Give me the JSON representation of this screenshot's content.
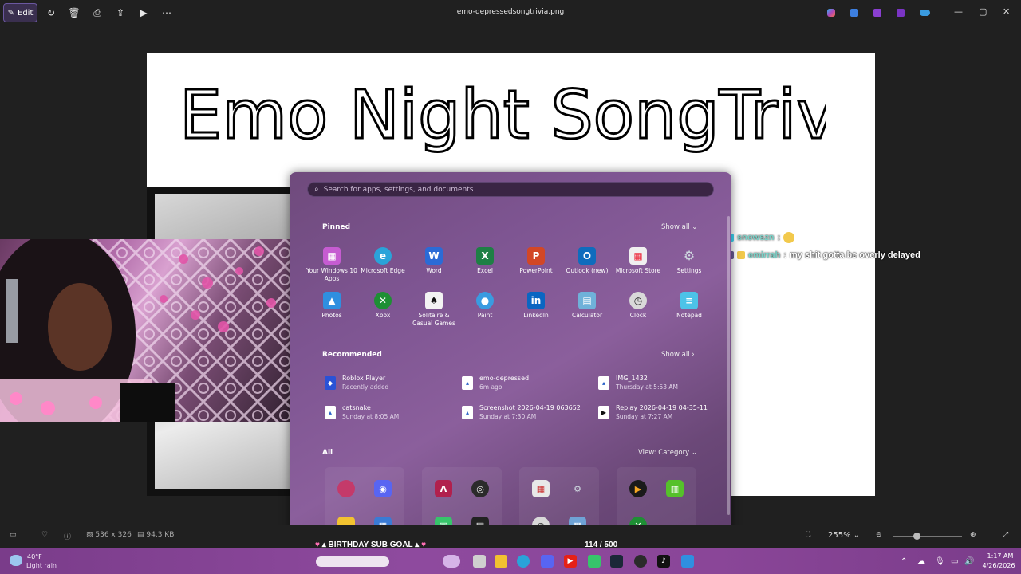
{
  "toolbar": {
    "edit_label": "Edit",
    "filename": "emo-depressedsongtrivia.png"
  },
  "image": {
    "handwritten_title": "Emo Night SongTrivia!"
  },
  "chat": [
    {
      "user": "snowszn",
      "sep": ":",
      "message": ""
    },
    {
      "user": "emirrah",
      "sep": ":",
      "message": "my shit gotta be overly delayed"
    }
  ],
  "start_menu": {
    "search_placeholder": "Search for apps, settings, and documents",
    "pinned_title": "Pinned",
    "pinned_show_all": "Show all",
    "pinned_apps": [
      {
        "label": "Your Windows 10 Apps",
        "icon": "windows-apps-icon",
        "color": "#c65cd1"
      },
      {
        "label": "Microsoft Edge",
        "icon": "edge-icon",
        "color": "#2aa3d9"
      },
      {
        "label": "Word",
        "icon": "word-icon",
        "color": "#2b6bd6"
      },
      {
        "label": "Excel",
        "icon": "excel-icon",
        "color": "#1e7f45"
      },
      {
        "label": "PowerPoint",
        "icon": "powerpoint-icon",
        "color": "#d24726"
      },
      {
        "label": "Outlook (new)",
        "icon": "outlook-icon",
        "color": "#0f6cbd"
      },
      {
        "label": "Microsoft Store",
        "icon": "store-icon",
        "color": "#f0f0f0"
      },
      {
        "label": "Settings",
        "icon": "settings-icon",
        "color": "#8a8a8a"
      },
      {
        "label": "Photos",
        "icon": "photos-icon",
        "color": "#2f8fe0"
      },
      {
        "label": "Xbox",
        "icon": "xbox-icon",
        "color": "#1e8f34"
      },
      {
        "label": "Solitaire & Casual Games",
        "icon": "solitaire-icon",
        "color": "#f3f3f3"
      },
      {
        "label": "Paint",
        "icon": "paint-icon",
        "color": "#3a9be0"
      },
      {
        "label": "LinkedIn",
        "icon": "linkedin-icon",
        "color": "#0a66c2"
      },
      {
        "label": "Calculator",
        "icon": "calculator-icon",
        "color": "#6fb1d9"
      },
      {
        "label": "Clock",
        "icon": "clock-icon",
        "color": "#d9d9d9"
      },
      {
        "label": "Notepad",
        "icon": "notepad-icon",
        "color": "#4cc3e8"
      }
    ],
    "recommended_title": "Recommended",
    "recommended_show_all": "Show all",
    "recommended": [
      {
        "name": "Roblox Player",
        "detail": "Recently added"
      },
      {
        "name": "emo-depressed",
        "detail": "6m ago"
      },
      {
        "name": "IMG_1432",
        "detail": "Thursday at 5:53 AM"
      },
      {
        "name": "catsnake",
        "detail": "Sunday at 8:05 AM"
      },
      {
        "name": "Screenshot 2026-04-19 063652",
        "detail": "Sunday at 7:30 AM"
      },
      {
        "name": "Replay 2026-04-19 04-35-11",
        "detail": "Sunday at 7:27 AM"
      }
    ],
    "all_title": "All",
    "view_label": "View: Category"
  },
  "bottombar": {
    "dimensions": "536 x 326",
    "filesize": "94.3 KB",
    "zoom": "255%"
  },
  "overlay": {
    "goal_text": "BIRTHDAY SUB GOAL",
    "goal_count": "114 / 500"
  },
  "taskbar": {
    "weather_temp": "40°F",
    "weather_desc": "Light rain",
    "time": "1:17 AM",
    "date": "4/26/2026"
  },
  "colors": {
    "accent": "#8e4a9e",
    "start_bg": "#7e5592",
    "edit_btn": "#3a2f4f"
  }
}
